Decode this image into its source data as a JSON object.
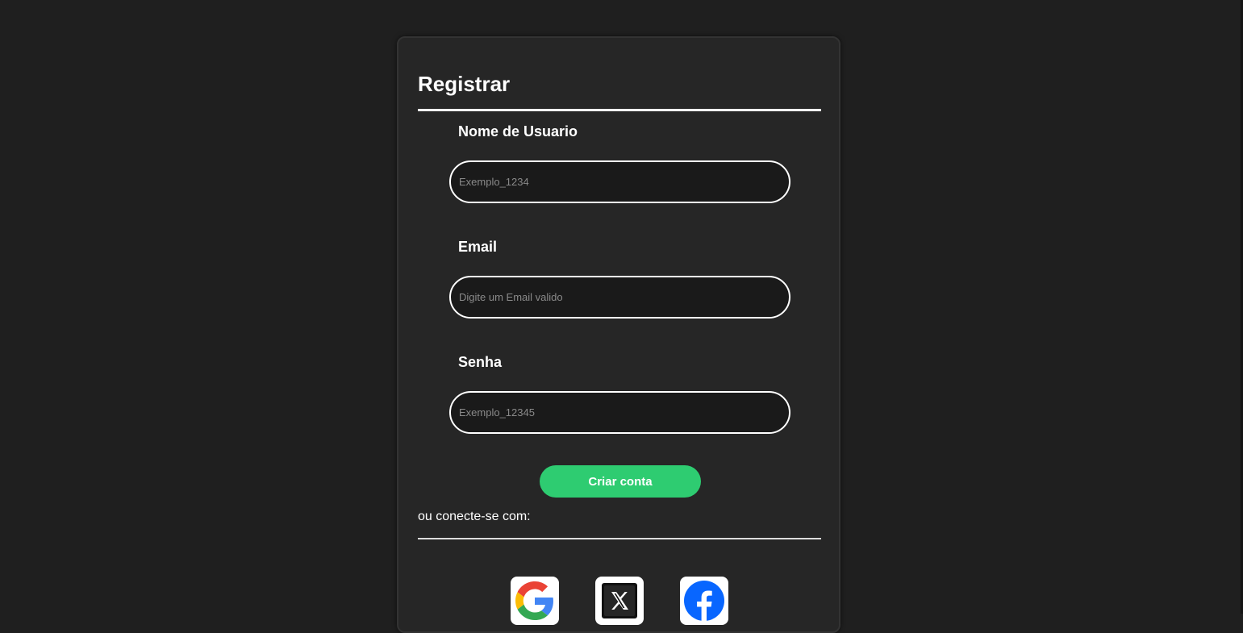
{
  "register": {
    "title": "Registrar",
    "fields": [
      {
        "label": "Nome de Usuario",
        "placeholder": "Exemplo_1234",
        "value": ""
      },
      {
        "label": "Email",
        "placeholder": "Digite um Email valido",
        "value": ""
      },
      {
        "label": "Senha",
        "placeholder": "Exemplo_12345",
        "value": ""
      }
    ],
    "submit_label": "Criar conta",
    "social_caption": "ou conecte-se com:",
    "social_buttons": [
      {
        "name": "Google",
        "icon": "google-icon"
      },
      {
        "name": "X",
        "icon": "x-icon"
      },
      {
        "name": "Facebook",
        "icon": "facebook-icon"
      }
    ]
  },
  "colors": {
    "background": "#1f1f1f",
    "card": "#262626",
    "accent": "#2ecc71",
    "input_bg": "#1a1a1a",
    "text": "#ffffff",
    "facebook": "#0866ff"
  }
}
